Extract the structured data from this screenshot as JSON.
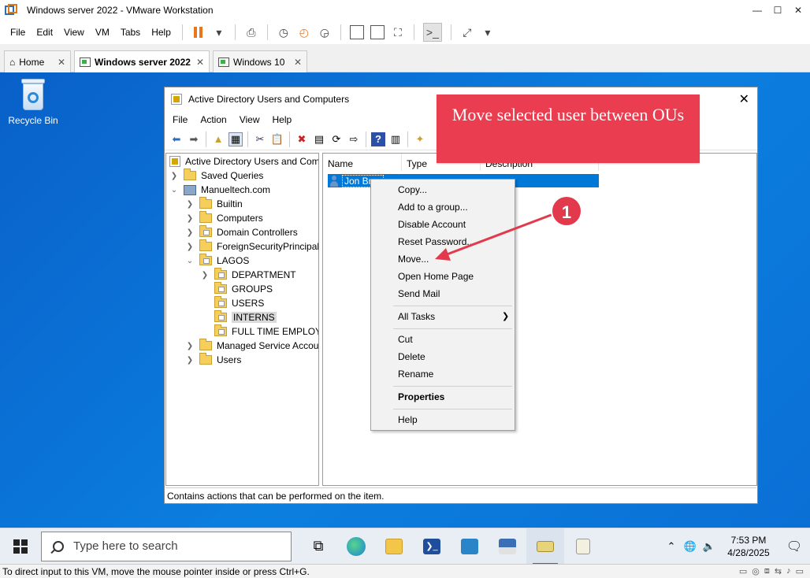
{
  "vmware": {
    "title": "Windows server 2022 - VMware Workstation",
    "window_controls": {
      "minimize": "—",
      "maximize": "☐",
      "close": "✕"
    },
    "menu": [
      "File",
      "Edit",
      "View",
      "VM",
      "Tabs",
      "Help"
    ],
    "tabs": [
      {
        "label": "Home"
      },
      {
        "label": "Windows server 2022"
      },
      {
        "label": "Windows 10"
      }
    ],
    "tab_close": "✕",
    "status_text": "To direct input to this VM, move the mouse pointer inside or press Ctrl+G."
  },
  "desktop": {
    "recycle_bin_label": "Recycle Bin"
  },
  "aduc": {
    "title": "Active Directory Users and Computers",
    "window_controls": {
      "maximize": "☐",
      "close": "✕"
    },
    "menu": [
      "File",
      "Action",
      "View",
      "Help"
    ],
    "tree": {
      "root": "Active Directory Users and Com",
      "saved_queries": "Saved Queries",
      "domain": "Manueltech.com",
      "builtin": "Builtin",
      "computers": "Computers",
      "domain_controllers": "Domain Controllers",
      "foreign": "ForeignSecurityPrincipals",
      "lagos": "LAGOS",
      "department": "DEPARTMENT",
      "groups": "GROUPS",
      "users_ou": "USERS",
      "interns": "INTERNS",
      "full_time": "FULL TIME EMPLOYE",
      "managed": "Managed Service Accour",
      "users": "Users"
    },
    "columns": {
      "name": "Name",
      "type": "Type",
      "description": "Description"
    },
    "selected_user": "Jon Brov",
    "status_bar": "Contains actions that can be performed on the item."
  },
  "context_menu": {
    "copy": "Copy...",
    "add_group": "Add to a group...",
    "disable": "Disable Account",
    "reset": "Reset Password...",
    "move": "Move...",
    "open_home": "Open Home Page",
    "send_mail": "Send Mail",
    "all_tasks": "All Tasks",
    "cut": "Cut",
    "delete": "Delete",
    "rename": "Rename",
    "properties": "Properties",
    "help": "Help"
  },
  "annotation": {
    "callout": "Move selected user between OUs",
    "step": "1",
    "color": "#ea3d4f"
  },
  "taskbar": {
    "search_placeholder": "Type here to search",
    "time": "7:53 PM",
    "date": "4/28/2025"
  }
}
